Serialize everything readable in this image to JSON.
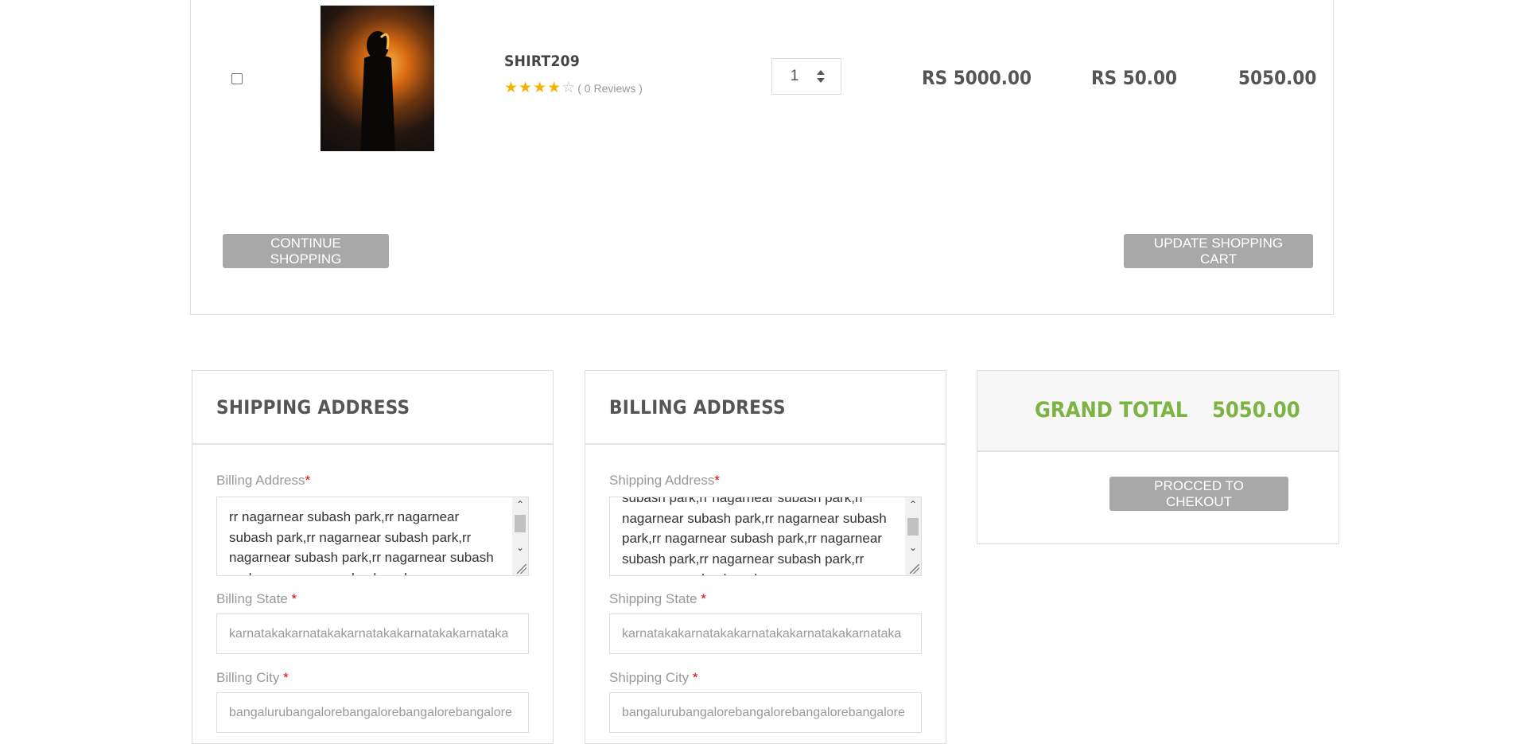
{
  "product": {
    "name": "SHIRT209",
    "rating": 4,
    "rating_max": 5,
    "reviews_label": "( 0 Reviews )",
    "quantity": "1",
    "unit_price": "RS 5000.00",
    "shipping": "RS 50.00",
    "subtotal": "5050.00"
  },
  "cart_actions": {
    "continue_label": "CONTINUE SHOPPING",
    "update_label": "UPDATE SHOPPING CART"
  },
  "shipping_panel": {
    "title": "SHIPPING ADDRESS",
    "address_label": "Billing Address",
    "address_value": "rr nagarnear subash park,rr nagarnear subash park,rr nagarnear subash park,rr nagarnear subash park,rr nagarnear subash park,rr nagarnear subash park,rr",
    "state_label": "Billing State",
    "state_value": "karnatakakarnatakakarnatakakarnatakakarnataka",
    "city_label": "Billing City",
    "city_value": "bangalurubangalorebangalorebangalorebangalore"
  },
  "billing_panel": {
    "title": "BILLING ADDRESS",
    "address_label": "Shipping Address",
    "address_value": "subash park,rr nagarnear subash park,rr nagarnear subash park,rr nagarnear subash park,rr nagarnear subash park,rr nagarnear subash park,rr nagarnear subash park,rr nagarnear subash park,rr",
    "state_label": "Shipping State",
    "state_value": "karnatakakarnatakakarnatakakarnatakakarnataka",
    "city_label": "Shipping City",
    "city_value": "bangalurubangalorebangalorebangalorebangalore"
  },
  "summary": {
    "grand_total_label": "GRAND TOTAL",
    "grand_total_value": "5050.00",
    "checkout_label": "PROCCED TO CHEKOUT"
  },
  "required_marker": "*",
  "colors": {
    "accent_green": "#7cb342",
    "button_gray": "#a8a8a8",
    "required_red": "#e60000"
  }
}
